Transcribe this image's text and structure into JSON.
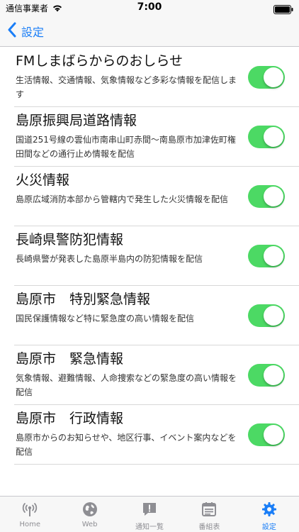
{
  "status_bar": {
    "carrier": "通信事業者",
    "time": "7:00"
  },
  "nav": {
    "back_label": "設定"
  },
  "settings": [
    {
      "title": "FMしまばらからのおしらせ",
      "desc": "生活情報、交通情報、気象情報など多彩な情報を配信します",
      "enabled": true
    },
    {
      "title": "島原振興局道路情報",
      "desc": "国道251号線の雲仙市南串山町赤間〜南島原市加津佐町権田間などの通行止め情報を配信",
      "enabled": true
    },
    {
      "title": "火災情報",
      "desc": "島原広域消防本部から管轄内で発生した火災情報を配信",
      "enabled": true
    },
    {
      "title": "長崎県警防犯情報",
      "desc": "長崎県警が発表した島原半島内の防犯情報を配信",
      "enabled": true
    },
    {
      "title": "島原市　特別緊急情報",
      "desc": "国民保護情報など特に緊急度の高い情報を配信",
      "enabled": true
    },
    {
      "title": "島原市　緊急情報",
      "desc": "気象情報、避難情報、人命捜索などの緊急度の高い情報を配信",
      "enabled": true
    },
    {
      "title": "島原市　行政情報",
      "desc": "島原市からのお知らせや、地区行事、イベント案内などを配信",
      "enabled": true
    }
  ],
  "tabs": [
    {
      "label": "Home",
      "icon": "broadcast-icon"
    },
    {
      "label": "Web",
      "icon": "globe-icon"
    },
    {
      "label": "通知一覧",
      "icon": "alert-icon"
    },
    {
      "label": "番組表",
      "icon": "calendar-icon"
    },
    {
      "label": "設定",
      "icon": "gear-icon",
      "active": true
    }
  ],
  "colors": {
    "accent": "#1a7ef7",
    "toggle_on": "#4cd964",
    "tab_inactive": "#8e8e93"
  }
}
